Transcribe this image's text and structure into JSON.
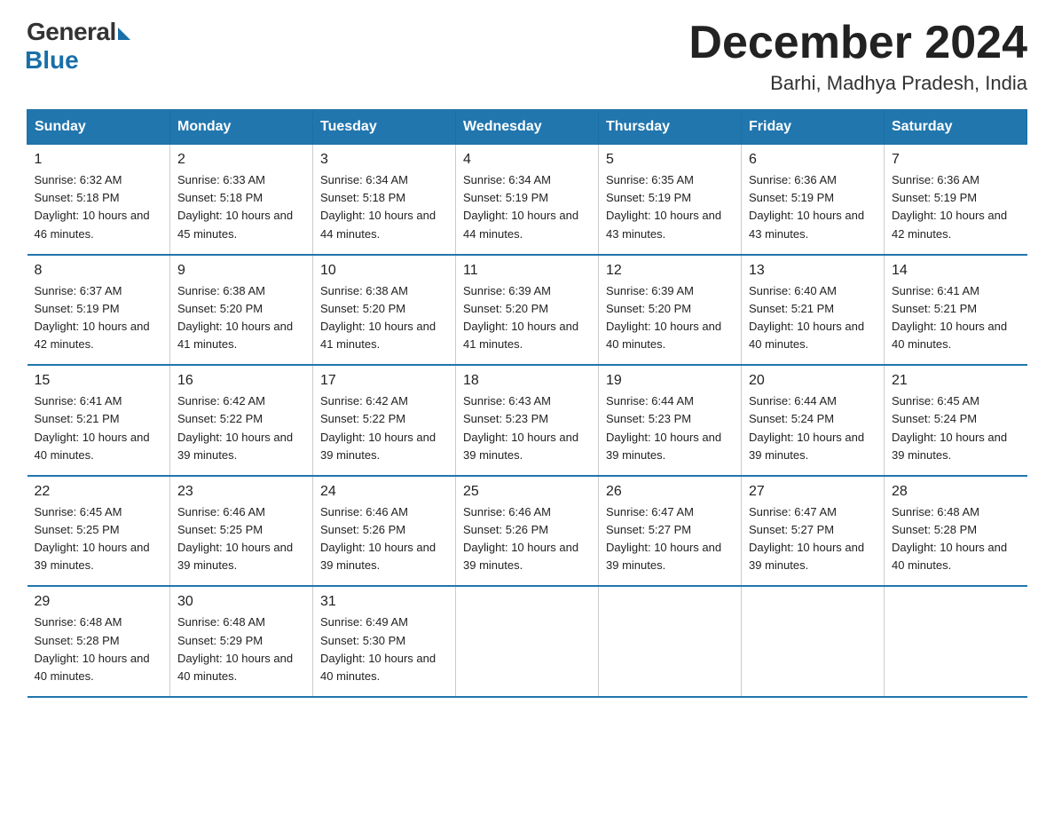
{
  "header": {
    "logo_general": "General",
    "logo_blue": "Blue",
    "month": "December 2024",
    "location": "Barhi, Madhya Pradesh, India"
  },
  "days_of_week": [
    "Sunday",
    "Monday",
    "Tuesday",
    "Wednesday",
    "Thursday",
    "Friday",
    "Saturday"
  ],
  "weeks": [
    [
      {
        "day": "1",
        "sunrise": "6:32 AM",
        "sunset": "5:18 PM",
        "daylight": "10 hours and 46 minutes."
      },
      {
        "day": "2",
        "sunrise": "6:33 AM",
        "sunset": "5:18 PM",
        "daylight": "10 hours and 45 minutes."
      },
      {
        "day": "3",
        "sunrise": "6:34 AM",
        "sunset": "5:18 PM",
        "daylight": "10 hours and 44 minutes."
      },
      {
        "day": "4",
        "sunrise": "6:34 AM",
        "sunset": "5:19 PM",
        "daylight": "10 hours and 44 minutes."
      },
      {
        "day": "5",
        "sunrise": "6:35 AM",
        "sunset": "5:19 PM",
        "daylight": "10 hours and 43 minutes."
      },
      {
        "day": "6",
        "sunrise": "6:36 AM",
        "sunset": "5:19 PM",
        "daylight": "10 hours and 43 minutes."
      },
      {
        "day": "7",
        "sunrise": "6:36 AM",
        "sunset": "5:19 PM",
        "daylight": "10 hours and 42 minutes."
      }
    ],
    [
      {
        "day": "8",
        "sunrise": "6:37 AM",
        "sunset": "5:19 PM",
        "daylight": "10 hours and 42 minutes."
      },
      {
        "day": "9",
        "sunrise": "6:38 AM",
        "sunset": "5:20 PM",
        "daylight": "10 hours and 41 minutes."
      },
      {
        "day": "10",
        "sunrise": "6:38 AM",
        "sunset": "5:20 PM",
        "daylight": "10 hours and 41 minutes."
      },
      {
        "day": "11",
        "sunrise": "6:39 AM",
        "sunset": "5:20 PM",
        "daylight": "10 hours and 41 minutes."
      },
      {
        "day": "12",
        "sunrise": "6:39 AM",
        "sunset": "5:20 PM",
        "daylight": "10 hours and 40 minutes."
      },
      {
        "day": "13",
        "sunrise": "6:40 AM",
        "sunset": "5:21 PM",
        "daylight": "10 hours and 40 minutes."
      },
      {
        "day": "14",
        "sunrise": "6:41 AM",
        "sunset": "5:21 PM",
        "daylight": "10 hours and 40 minutes."
      }
    ],
    [
      {
        "day": "15",
        "sunrise": "6:41 AM",
        "sunset": "5:21 PM",
        "daylight": "10 hours and 40 minutes."
      },
      {
        "day": "16",
        "sunrise": "6:42 AM",
        "sunset": "5:22 PM",
        "daylight": "10 hours and 39 minutes."
      },
      {
        "day": "17",
        "sunrise": "6:42 AM",
        "sunset": "5:22 PM",
        "daylight": "10 hours and 39 minutes."
      },
      {
        "day": "18",
        "sunrise": "6:43 AM",
        "sunset": "5:23 PM",
        "daylight": "10 hours and 39 minutes."
      },
      {
        "day": "19",
        "sunrise": "6:44 AM",
        "sunset": "5:23 PM",
        "daylight": "10 hours and 39 minutes."
      },
      {
        "day": "20",
        "sunrise": "6:44 AM",
        "sunset": "5:24 PM",
        "daylight": "10 hours and 39 minutes."
      },
      {
        "day": "21",
        "sunrise": "6:45 AM",
        "sunset": "5:24 PM",
        "daylight": "10 hours and 39 minutes."
      }
    ],
    [
      {
        "day": "22",
        "sunrise": "6:45 AM",
        "sunset": "5:25 PM",
        "daylight": "10 hours and 39 minutes."
      },
      {
        "day": "23",
        "sunrise": "6:46 AM",
        "sunset": "5:25 PM",
        "daylight": "10 hours and 39 minutes."
      },
      {
        "day": "24",
        "sunrise": "6:46 AM",
        "sunset": "5:26 PM",
        "daylight": "10 hours and 39 minutes."
      },
      {
        "day": "25",
        "sunrise": "6:46 AM",
        "sunset": "5:26 PM",
        "daylight": "10 hours and 39 minutes."
      },
      {
        "day": "26",
        "sunrise": "6:47 AM",
        "sunset": "5:27 PM",
        "daylight": "10 hours and 39 minutes."
      },
      {
        "day": "27",
        "sunrise": "6:47 AM",
        "sunset": "5:27 PM",
        "daylight": "10 hours and 39 minutes."
      },
      {
        "day": "28",
        "sunrise": "6:48 AM",
        "sunset": "5:28 PM",
        "daylight": "10 hours and 40 minutes."
      }
    ],
    [
      {
        "day": "29",
        "sunrise": "6:48 AM",
        "sunset": "5:28 PM",
        "daylight": "10 hours and 40 minutes."
      },
      {
        "day": "30",
        "sunrise": "6:48 AM",
        "sunset": "5:29 PM",
        "daylight": "10 hours and 40 minutes."
      },
      {
        "day": "31",
        "sunrise": "6:49 AM",
        "sunset": "5:30 PM",
        "daylight": "10 hours and 40 minutes."
      },
      null,
      null,
      null,
      null
    ]
  ]
}
